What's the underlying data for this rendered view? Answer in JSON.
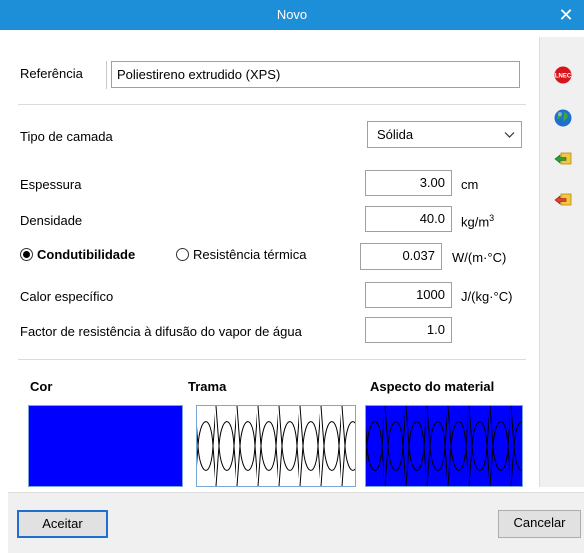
{
  "window": {
    "title": "Novo",
    "close_glyph": "✕"
  },
  "form": {
    "referencia": {
      "label": "Referência",
      "value": "Poliestireno extrudido (XPS)"
    },
    "tipo_camada": {
      "label": "Tipo de camada",
      "value": "Sólida"
    },
    "espessura": {
      "label": "Espessura",
      "value": "3.00",
      "unit": "cm"
    },
    "densidade": {
      "label": "Densidade",
      "value": "40.0",
      "unit": "kg/m",
      "unit_sup": "3"
    },
    "condutibilidade": {
      "radio_label": "Condutibilidade",
      "alt_radio_label": "Resistência térmica",
      "value": "0.037",
      "unit": "W/(m·°C)"
    },
    "calor": {
      "label": "Calor específico",
      "value": "1000",
      "unit": "J/(kg·°C)"
    },
    "factor": {
      "label": "Factor de resistência à difusão do vapor de água",
      "value": "1.0"
    }
  },
  "swatches": {
    "cor": {
      "title": "Cor",
      "color": "#0000ff"
    },
    "trama": {
      "title": "Trama"
    },
    "aspecto": {
      "title": "Aspecto do material",
      "color": "#0000ff"
    }
  },
  "side_icons": [
    "lnec-icon",
    "globe-icon",
    "import-arrow-icon",
    "export-arrow-icon"
  ],
  "side_icon_texts": {
    "lnec": "LNEC"
  },
  "footer": {
    "accept": "Aceitar",
    "cancel": "Cancelar"
  },
  "colors": {
    "titlebar": "#1c8fd8",
    "swatch_blue": "#0000ff"
  }
}
